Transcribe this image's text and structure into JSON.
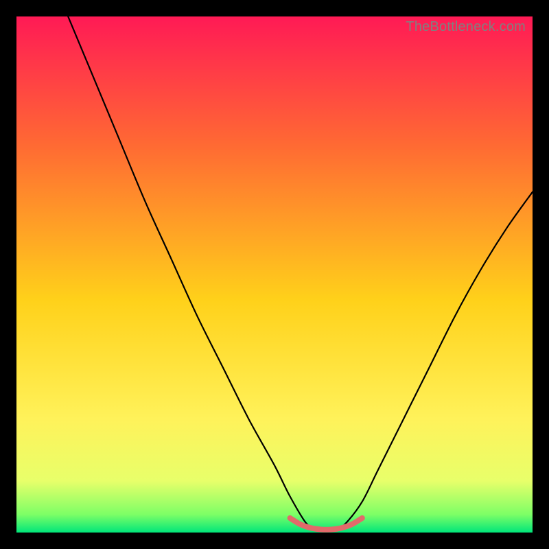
{
  "watermark": {
    "text": "TheBottleneck.com"
  },
  "colors": {
    "gradient_stops": [
      {
        "offset": 0.0,
        "color": "#ff1a55"
      },
      {
        "offset": 0.25,
        "color": "#ff6a33"
      },
      {
        "offset": 0.55,
        "color": "#ffd11a"
      },
      {
        "offset": 0.78,
        "color": "#fff25a"
      },
      {
        "offset": 0.9,
        "color": "#e8ff6a"
      },
      {
        "offset": 0.965,
        "color": "#7dff66"
      },
      {
        "offset": 1.0,
        "color": "#00e67a"
      }
    ],
    "line": "#000000",
    "marker": "#e26a6a",
    "frame": "#000000"
  },
  "chart_data": {
    "type": "line",
    "title": "",
    "xlabel": "",
    "ylabel": "",
    "xlim": [
      0,
      100
    ],
    "ylim": [
      0,
      100
    ],
    "note": "V-shaped bottleneck curve. Minimum (best match) around x≈56–64. y is the normalised mismatch/bottleneck %; 0 = ideal, 100 = worst.",
    "series": [
      {
        "name": "bottleneck-curve",
        "x": [
          10,
          15,
          20,
          25,
          30,
          35,
          40,
          45,
          50,
          53,
          56,
          58,
          60,
          62,
          64,
          67,
          70,
          75,
          80,
          85,
          90,
          95,
          100
        ],
        "values": [
          100,
          88,
          76,
          64,
          53,
          42,
          32,
          22,
          13,
          7,
          2,
          0.5,
          0.3,
          0.5,
          2,
          6,
          12,
          22,
          32,
          42,
          51,
          59,
          66
        ]
      },
      {
        "name": "optimal-band-marker",
        "x": [
          53,
          55,
          57,
          59,
          61,
          63,
          65,
          67
        ],
        "values": [
          2.8,
          1.6,
          0.9,
          0.6,
          0.6,
          0.9,
          1.6,
          2.8
        ]
      }
    ]
  }
}
